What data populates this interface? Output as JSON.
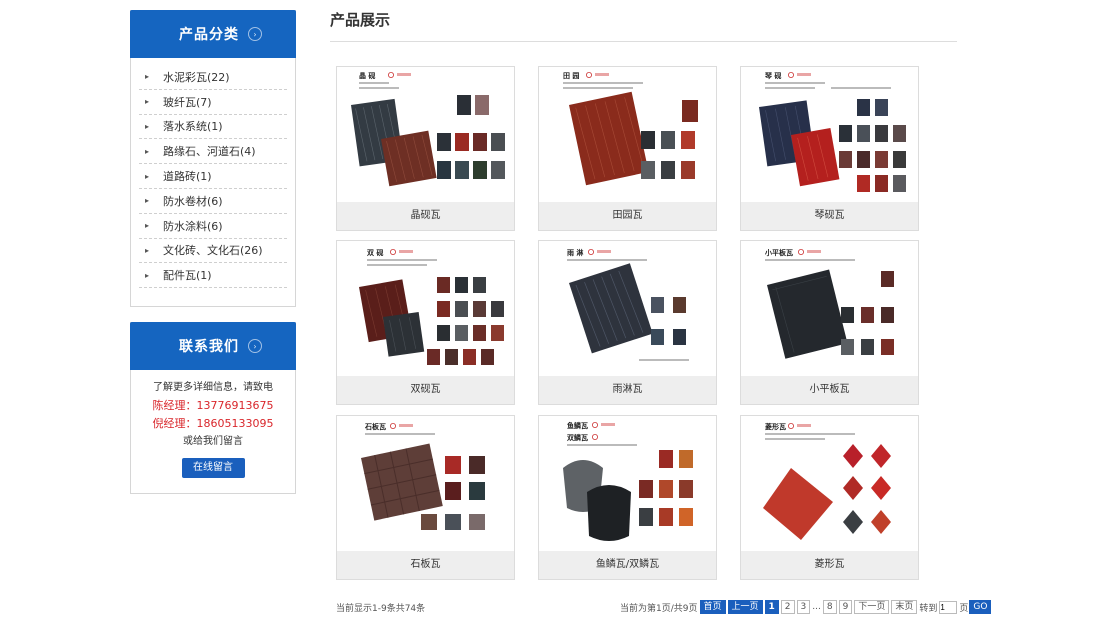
{
  "sidebar": {
    "categories": {
      "title": "产品分类",
      "items": [
        {
          "label": "水泥彩瓦(22)"
        },
        {
          "label": "玻纤瓦(7)"
        },
        {
          "label": "落水系统(1)"
        },
        {
          "label": "路缘石、河道石(4)"
        },
        {
          "label": "道路砖(1)"
        },
        {
          "label": "防水卷材(6)"
        },
        {
          "label": "防水涂料(6)"
        },
        {
          "label": "文化砖、文化石(26)"
        },
        {
          "label": "配件瓦(1)"
        }
      ]
    },
    "contact": {
      "title": "联系我们",
      "intro": "了解更多详细信息，请致电",
      "phone1": "陈经理：13776913675",
      "phone2": "倪经理：18605133095",
      "or": "或给我们留言",
      "button": "在线留言"
    }
  },
  "main": {
    "title": "产品展示",
    "products": [
      {
        "name": "晶砚瓦",
        "img_title": "晶 砚"
      },
      {
        "name": "田园瓦",
        "img_title": "田 园"
      },
      {
        "name": "琴砚瓦",
        "img_title": "琴 砚"
      },
      {
        "name": "双砚瓦",
        "img_title": "双 砚"
      },
      {
        "name": "雨淋瓦",
        "img_title": "雨 淋"
      },
      {
        "name": "小平板瓦",
        "img_title": "小平板瓦"
      },
      {
        "name": "石板瓦",
        "img_title": "石板瓦"
      },
      {
        "name": "鱼鳞瓦/双鳞瓦",
        "img_title": "鱼鳞瓦",
        "img_title2": "双鳞瓦"
      },
      {
        "name": "菱形瓦",
        "img_title": "菱形瓦"
      }
    ]
  },
  "pagination": {
    "summary": "当前显示1-9条共74条",
    "current_info": "当前为第1页/共9页",
    "first": "首页",
    "prev": "上一页",
    "pages": [
      "1",
      "2",
      "3",
      "8",
      "9"
    ],
    "ellipsis": "...",
    "next": "下一页",
    "last": "末页",
    "goto_label": "转到",
    "page_unit": "页",
    "go": "GO",
    "goto_value": "1"
  },
  "colors": {
    "brand_blue": "#1565c0",
    "phone_red": "#d9262b"
  }
}
